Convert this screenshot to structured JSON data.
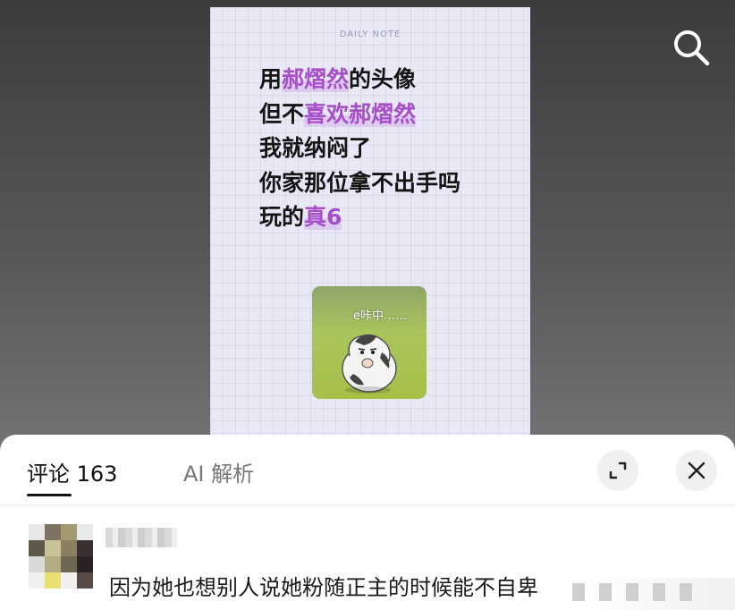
{
  "note_card": {
    "header": "DAILY NOTE",
    "lines": [
      {
        "parts": [
          {
            "text": "用",
            "highlight": false
          },
          {
            "text": "郝熠然",
            "highlight": true
          },
          {
            "text": "的头像",
            "highlight": false
          }
        ]
      },
      {
        "parts": [
          {
            "text": "但不",
            "highlight": false
          },
          {
            "text": "喜欢郝熠然",
            "highlight": true
          }
        ]
      },
      {
        "parts": [
          {
            "text": "我就纳闷了",
            "highlight": false
          }
        ]
      },
      {
        "parts": [
          {
            "text": "你家那位拿不出手吗",
            "highlight": false
          }
        ]
      },
      {
        "parts": [
          {
            "text": "玩的",
            "highlight": false
          },
          {
            "text": "真6",
            "highlight": true
          }
        ]
      }
    ],
    "sticker_text": "e咔中……"
  },
  "top_bar": {
    "search_icon": "search-icon"
  },
  "comments_panel": {
    "tab_comments": "评论 163",
    "tab_ai": "AI 解析",
    "expand_icon": "expand-icon",
    "close_icon": "close-icon"
  },
  "comment": {
    "text": "因为她也想别人说她粉随正主的时候能不自卑"
  },
  "colors": {
    "highlight": "#a64fc8",
    "card_bg": "#e9e8f6",
    "sheet_bg": "#ffffff"
  }
}
